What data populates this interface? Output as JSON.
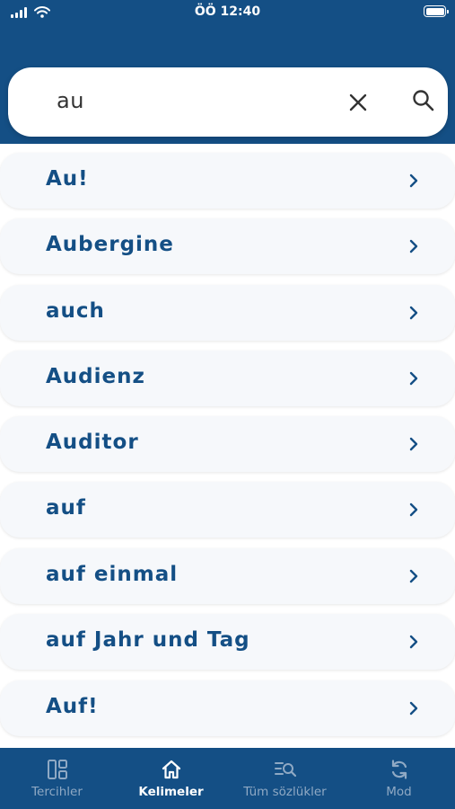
{
  "status": {
    "time": "ÖÖ 12:40"
  },
  "search": {
    "query": "au"
  },
  "results": [
    {
      "label": "Au!"
    },
    {
      "label": "Aubergine"
    },
    {
      "label": "auch"
    },
    {
      "label": "Audienz"
    },
    {
      "label": "Auditor"
    },
    {
      "label": "auf"
    },
    {
      "label": "auf einmal"
    },
    {
      "label": "auf Jahr und Tag"
    },
    {
      "label": "Auf!"
    }
  ],
  "tabs": [
    {
      "label": "Tercihler",
      "icon": "layout-icon",
      "active": false
    },
    {
      "label": "Kelimeler",
      "icon": "home-icon",
      "active": true
    },
    {
      "label": "Tüm sözlükler",
      "icon": "list-search-icon",
      "active": false
    },
    {
      "label": "Mod",
      "icon": "sync-icon",
      "active": false
    }
  ],
  "colors": {
    "primary": "#144f85",
    "row_bg": "#f6f8fb",
    "tab_inactive": "#8fa9c4"
  }
}
